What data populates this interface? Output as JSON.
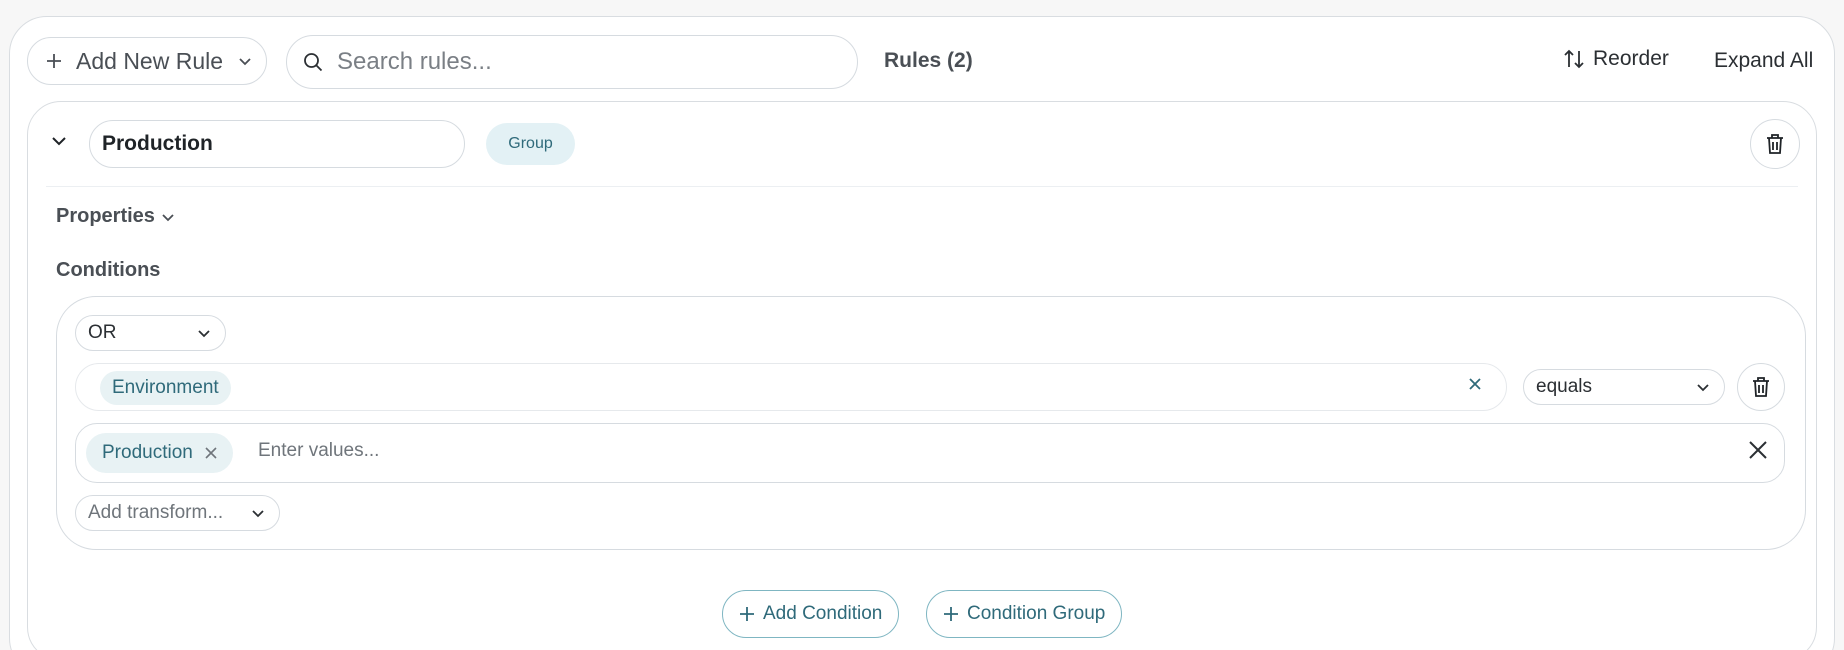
{
  "toolbar": {
    "add_rule_label": "Add New Rule",
    "search_placeholder": "Search rules...",
    "search_value": "",
    "rules_count": "Rules (2)",
    "reorder_label": "Reorder",
    "expand_all_label": "Expand All"
  },
  "rule": {
    "name": "Production",
    "badge": "Group",
    "properties_label": "Properties",
    "conditions_label": "Conditions",
    "conditions": {
      "logic": "OR",
      "field": "Environment",
      "operator": "equals",
      "values": [
        "Production"
      ],
      "values_placeholder": "Enter values...",
      "transform_placeholder": "Add transform..."
    },
    "add_condition_label": "Add Condition",
    "condition_group_label": "Condition Group"
  },
  "colors": {
    "accent": "#2f6a7a",
    "chip_bg": "#e8f2f4",
    "border": "#d6dbe0"
  },
  "icons": [
    "plus-icon",
    "chevron-down-icon",
    "search-icon",
    "reorder-icon",
    "trash-icon",
    "close-icon"
  ]
}
